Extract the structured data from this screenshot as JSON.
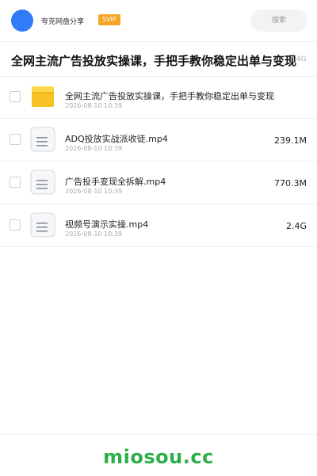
{
  "header": {
    "app_name": "夸克网盘分享",
    "badge": "SVIP",
    "search_placeholder": "搜索",
    "avatar_color": "#2f7cf6"
  },
  "share": {
    "title": "全网主流广告投放实操课，手把手教你稳定出单与变现",
    "total_size": "4G"
  },
  "files": [
    {
      "type": "folder",
      "icon": "folder-icon",
      "name": "全网主流广告投放实操课，手把手教你稳定出单与变现",
      "date": "2026-08-10 10:39",
      "size": ""
    },
    {
      "type": "video",
      "icon": "document-icon",
      "name": "ADQ投放实战派收徒.mp4",
      "date": "2026-08-10 10:39",
      "size": "239.1M"
    },
    {
      "type": "video",
      "icon": "document-icon",
      "name": "广告投手变现全拆解.mp4",
      "date": "2026-08-10 10:39",
      "size": "770.3M"
    },
    {
      "type": "video",
      "icon": "document-icon",
      "name": "视频号演示实操.mp4",
      "date": "2026-08-10 10:39",
      "size": "2.4G"
    }
  ],
  "footer": {
    "brand": "miosou.cc",
    "brand_color": "#2eae4a"
  }
}
